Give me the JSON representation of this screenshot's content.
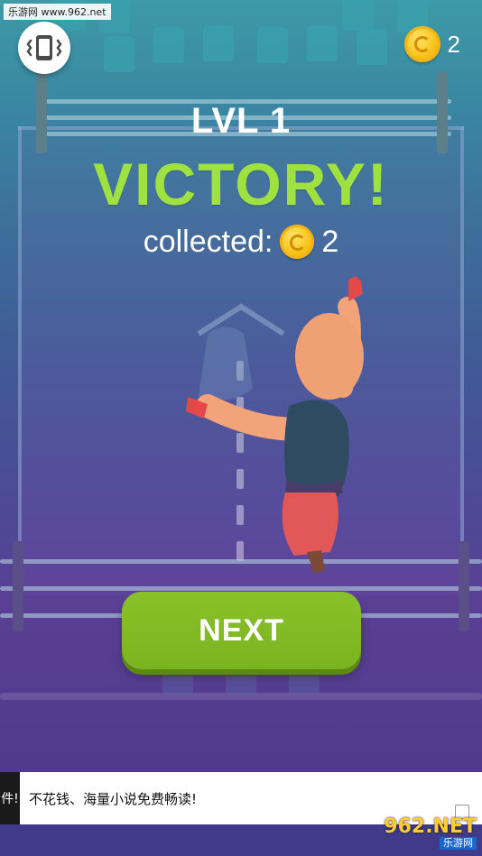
{
  "watermark": {
    "text": "乐游网 www.962.net"
  },
  "top_bar": {
    "vibrate_icon": "phone-vibrate-icon",
    "coin_icon": "coin-icon",
    "coin_count": "2"
  },
  "result": {
    "level_label": "LVL 1",
    "victory_label": "VICTORY!",
    "collected_label": "collected:",
    "collected_count": "2"
  },
  "next_button": {
    "label": "NEXT"
  },
  "ad_banner": {
    "thumb_text": "件!",
    "text": "不花钱、海量小说免费畅读!"
  },
  "site_logo": {
    "big": "962.NET",
    "small": "乐游网"
  },
  "colors": {
    "victory": "#9fe23f",
    "next_button": "#7bb41e",
    "coin": "#f8c21a"
  }
}
